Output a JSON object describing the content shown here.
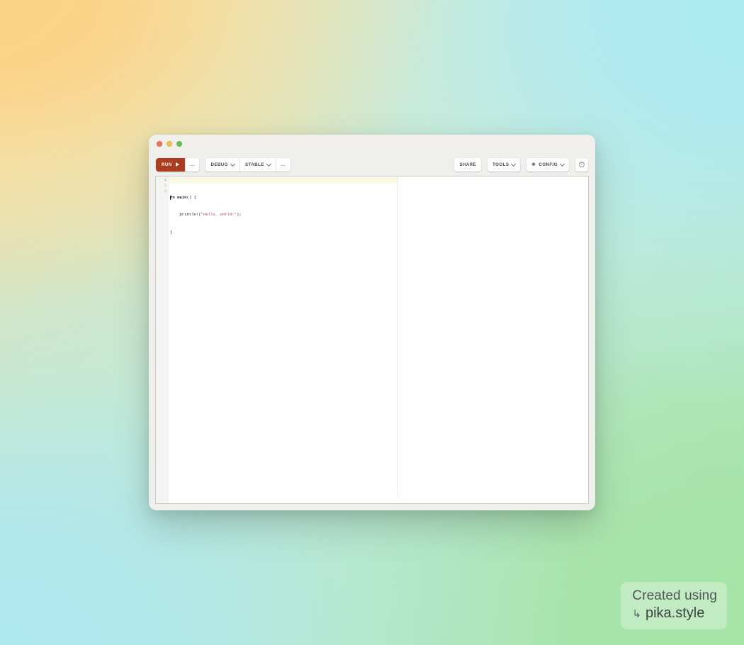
{
  "window": {
    "traffic_lights": [
      {
        "name": "close",
        "color": "#ef6f5e"
      },
      {
        "name": "minimize",
        "color": "#f5bd4f"
      },
      {
        "name": "zoom",
        "color": "#61c454"
      }
    ]
  },
  "toolbar": {
    "run_label": "RUN",
    "run_more_label": "…",
    "mode_label": "DEBUG",
    "channel_label": "STABLE",
    "build_more_label": "…",
    "share_label": "SHARE",
    "tools_label": "TOOLS",
    "config_label": "CONFIG",
    "help_label": "?",
    "run_color": "#ab3c20"
  },
  "editor": {
    "active_line": 1,
    "gutter": [
      "1",
      "2",
      "3"
    ],
    "lines": [
      {
        "number": "1",
        "tokens": [
          {
            "text": "fn",
            "type": "kw"
          },
          {
            "text": " ",
            "type": "punct"
          },
          {
            "text": "main",
            "type": "fnname"
          },
          {
            "text": "() {",
            "type": "punct"
          }
        ]
      },
      {
        "number": "2",
        "tokens": [
          {
            "text": "    println!(",
            "type": "punct"
          },
          {
            "text": "\"Hello, world!\"",
            "type": "str"
          },
          {
            "text": ");",
            "type": "punct"
          }
        ]
      },
      {
        "number": "3",
        "tokens": [
          {
            "text": "}",
            "type": "punct"
          }
        ]
      }
    ],
    "plain_text": "fn main() {\n    println!(\"Hello, world!\");\n}",
    "string_color": "#cf4172",
    "active_line_color": "#fbf9e2"
  },
  "watermark": {
    "line1": "Created using",
    "arrow": "↳",
    "line2": "pika.style"
  }
}
